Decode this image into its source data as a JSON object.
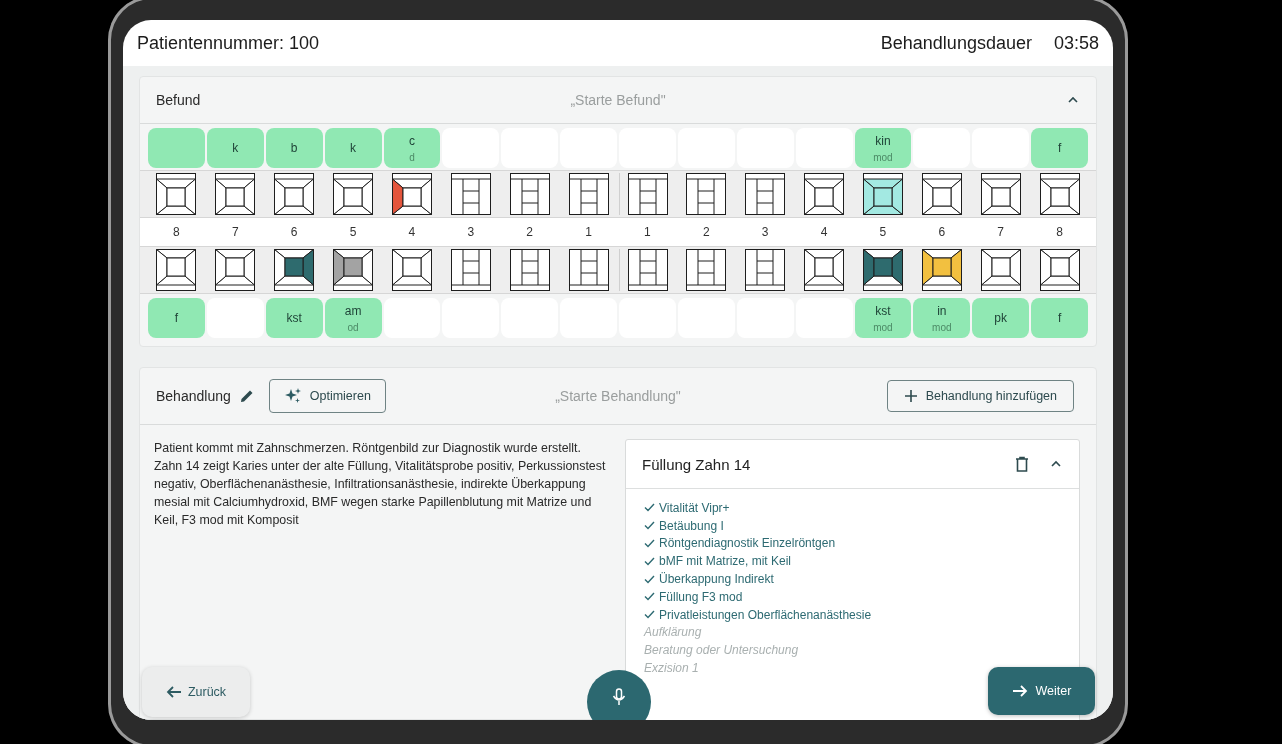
{
  "header": {
    "patient": "Patientennummer: 100",
    "duration_label": "Behandlungsdauer",
    "duration": "03:58"
  },
  "befund": {
    "title": "Befund",
    "prompt": "„Starte Befund\"",
    "numbers": [
      "8",
      "7",
      "6",
      "5",
      "4",
      "3",
      "2",
      "1",
      "1",
      "2",
      "3",
      "4",
      "5",
      "6",
      "7",
      "8"
    ],
    "upper": [
      {
        "kind": "molar",
        "label": {
          "marked": true
        }
      },
      {
        "kind": "molar",
        "label": {
          "marked": true,
          "text": "k"
        }
      },
      {
        "kind": "molar",
        "label": {
          "marked": true,
          "text": "b"
        }
      },
      {
        "kind": "molar",
        "label": {
          "marked": true,
          "text": "k"
        }
      },
      {
        "kind": "molar",
        "label": {
          "marked": true,
          "text": "c",
          "sub": "d"
        },
        "surfaces": [
          {
            "kind": "left",
            "color": "#e4553c"
          }
        ]
      },
      {
        "kind": "incisor",
        "label": {
          "marked": false
        }
      },
      {
        "kind": "incisor",
        "label": {
          "marked": false
        }
      },
      {
        "kind": "incisor",
        "label": {
          "marked": false
        }
      },
      {
        "kind": "incisor",
        "label": {
          "marked": false
        }
      },
      {
        "kind": "incisor",
        "label": {
          "marked": false
        }
      },
      {
        "kind": "incisor",
        "label": {
          "marked": false
        }
      },
      {
        "kind": "molar",
        "label": {
          "marked": false
        }
      },
      {
        "kind": "molar",
        "label": {
          "marked": true,
          "text": "kin",
          "sub": "mod"
        },
        "surfaces": [
          {
            "kind": "center",
            "color": "#a3e9e2"
          },
          {
            "kind": "left",
            "color": "#a3e9e2"
          },
          {
            "kind": "right",
            "color": "#a3e9e2"
          },
          {
            "kind": "top",
            "color": "#a3e9e2"
          },
          {
            "kind": "bottom",
            "color": "#a3e9e2"
          }
        ]
      },
      {
        "kind": "molar",
        "label": {
          "marked": false
        }
      },
      {
        "kind": "molar",
        "label": {
          "marked": false
        }
      },
      {
        "kind": "molar",
        "label": {
          "marked": true,
          "text": "f"
        }
      }
    ],
    "lower": [
      {
        "kind": "molar",
        "label": {
          "marked": true,
          "text": "f"
        }
      },
      {
        "kind": "molar",
        "label": {
          "marked": false
        }
      },
      {
        "kind": "molar",
        "label": {
          "marked": true,
          "text": "kst"
        },
        "surfaces": [
          {
            "kind": "center",
            "color": "#2e6b6e"
          },
          {
            "kind": "right",
            "color": "#2e6b6e"
          }
        ]
      },
      {
        "kind": "molar",
        "label": {
          "marked": true,
          "text": "am",
          "sub": "od"
        },
        "surfaces": [
          {
            "kind": "center",
            "color": "#a3a3a3"
          },
          {
            "kind": "left",
            "color": "#a3a3a3"
          }
        ]
      },
      {
        "kind": "molar",
        "label": {
          "marked": false
        }
      },
      {
        "kind": "incisor",
        "label": {
          "marked": false
        }
      },
      {
        "kind": "incisor",
        "label": {
          "marked": false
        }
      },
      {
        "kind": "incisor",
        "label": {
          "marked": false
        }
      },
      {
        "kind": "incisor",
        "label": {
          "marked": false
        }
      },
      {
        "kind": "incisor",
        "label": {
          "marked": false
        }
      },
      {
        "kind": "incisor",
        "label": {
          "marked": false
        }
      },
      {
        "kind": "molar",
        "label": {
          "marked": false
        }
      },
      {
        "kind": "molar",
        "label": {
          "marked": true,
          "text": "kst",
          "sub": "mod"
        },
        "surfaces": [
          {
            "kind": "center",
            "color": "#2e6b6e"
          },
          {
            "kind": "left",
            "color": "#2e6b6e"
          },
          {
            "kind": "right",
            "color": "#2e6b6e"
          }
        ]
      },
      {
        "kind": "molar",
        "label": {
          "marked": true,
          "text": "in",
          "sub": "mod"
        },
        "surfaces": [
          {
            "kind": "center",
            "color": "#f2c040"
          },
          {
            "kind": "left",
            "color": "#f2c040"
          },
          {
            "kind": "right",
            "color": "#f2c040"
          }
        ]
      },
      {
        "kind": "molar",
        "label": {
          "marked": true,
          "text": "pk"
        }
      },
      {
        "kind": "molar",
        "label": {
          "marked": true,
          "text": "f"
        }
      }
    ]
  },
  "behandlung": {
    "title": "Behandlung",
    "optimize_button": "Optimieren",
    "prompt": "„Starte Behandlung\"",
    "add_button": "Behandlung hinzufügen",
    "notes": "Patient kommt mit Zahnschmerzen. Röntgenbild zur Diagnostik wurde erstellt. Zahn 14 zeigt Karies unter der alte Füllung, Vitalitätsprobe positiv, Perkussionstest negativ, Oberflächenanästhesie, Infiltrationsanästhesie, indirekte Überkappung mesial mit Calciumhydroxid, BMF wegen starke Papillenblutung mit Matrize und Keil, F3 mod mit Komposit",
    "card": {
      "title": "Füllung Zahn 14",
      "items": [
        {
          "text": "Vitalität Vipr+",
          "done": true
        },
        {
          "text": "Betäubung I",
          "done": true
        },
        {
          "text": "Röntgendiagnostik Einzelröntgen",
          "done": true
        },
        {
          "text": "bMF mit Matrize, mit Keil",
          "done": true
        },
        {
          "text": "Überkappung Indirekt",
          "done": true
        },
        {
          "text": "Füllung F3 mod",
          "done": true
        },
        {
          "text": "Privatleistungen Oberflächenanästhesie",
          "done": true
        },
        {
          "text": "Aufklärung",
          "done": false
        },
        {
          "text": "Beratung oder Untersuchung",
          "done": false
        },
        {
          "text": "Exzision 1",
          "done": false
        }
      ]
    }
  },
  "footer": {
    "back_button": "Zurück",
    "next_button": "Weiter"
  }
}
